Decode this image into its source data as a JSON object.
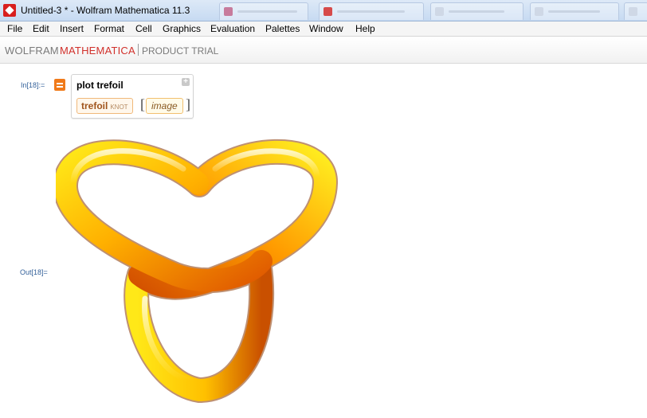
{
  "window": {
    "title": "Untitled-3 * - Wolfram Mathematica 11.3",
    "colors": {
      "accent": "#d81e1e",
      "titlebar": "#c6daf2"
    }
  },
  "menu": {
    "items": [
      "File",
      "Edit",
      "Insert",
      "Format",
      "Cell",
      "Graphics",
      "Evaluation",
      "Palettes",
      "Window",
      "Help"
    ]
  },
  "brand": {
    "wolfram": "WOLFRAM",
    "mathematica": "MATHEMATICA",
    "trial": "PRODUCT TRIAL"
  },
  "notebook": {
    "input_label": "In[18]:=",
    "output_label": "Out[18]=",
    "query": "plot trefoil",
    "entity_name": "trefoil",
    "entity_type": "KNOT",
    "bracket_open": "[",
    "bracket_close": "]",
    "property": "image"
  },
  "output": {
    "graphic": "trefoil-knot-3d-tube",
    "colors": {
      "light": "#ffe818",
      "mid": "#ffb000",
      "dark": "#e05a00",
      "shade": "#8a3600"
    }
  }
}
